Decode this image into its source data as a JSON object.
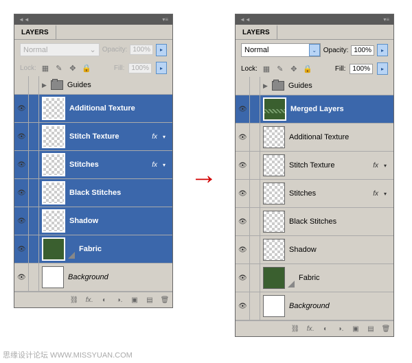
{
  "leftPanel": {
    "tab": "LAYERS",
    "blendMode": "Normal",
    "opacityLabel": "Opacity:",
    "opacityValue": "100%",
    "lockLabel": "Lock:",
    "fillLabel": "Fill:",
    "fillValue": "100%",
    "guides": "Guides",
    "layers": [
      {
        "name": "Additional Texture",
        "selected": true,
        "fx": false,
        "thumb": "trans"
      },
      {
        "name": "Stitch Texture",
        "selected": true,
        "fx": true,
        "thumb": "trans"
      },
      {
        "name": "Stitches",
        "selected": true,
        "fx": true,
        "thumb": "trans"
      },
      {
        "name": "Black Stitches",
        "selected": true,
        "fx": false,
        "thumb": "trans"
      },
      {
        "name": "Shadow",
        "selected": true,
        "fx": false,
        "thumb": "trans"
      },
      {
        "name": "Fabric",
        "selected": true,
        "fx": false,
        "thumb": "fabric"
      },
      {
        "name": "Background",
        "selected": false,
        "fx": false,
        "thumb": "white",
        "italic": true
      }
    ]
  },
  "rightPanel": {
    "tab": "LAYERS",
    "blendMode": "Normal",
    "opacityLabel": "Opacity:",
    "opacityValue": "100%",
    "lockLabel": "Lock:",
    "fillLabel": "Fill:",
    "fillValue": "100%",
    "guides": "Guides",
    "layers": [
      {
        "name": "Merged Layers",
        "selected": true,
        "fx": false,
        "thumb": "fabric-diag"
      },
      {
        "name": "Additional Texture",
        "selected": false,
        "fx": false,
        "thumb": "trans"
      },
      {
        "name": "Stitch Texture",
        "selected": false,
        "fx": true,
        "thumb": "trans"
      },
      {
        "name": "Stitches",
        "selected": false,
        "fx": true,
        "thumb": "trans"
      },
      {
        "name": "Black Stitches",
        "selected": false,
        "fx": false,
        "thumb": "trans"
      },
      {
        "name": "Shadow",
        "selected": false,
        "fx": false,
        "thumb": "trans"
      },
      {
        "name": "Fabric",
        "selected": false,
        "fx": false,
        "thumb": "fabric"
      },
      {
        "name": "Background",
        "selected": false,
        "fx": false,
        "thumb": "white",
        "italic": true
      }
    ]
  },
  "watermark": "思缘设计论坛   WWW.MISSYUAN.COM"
}
